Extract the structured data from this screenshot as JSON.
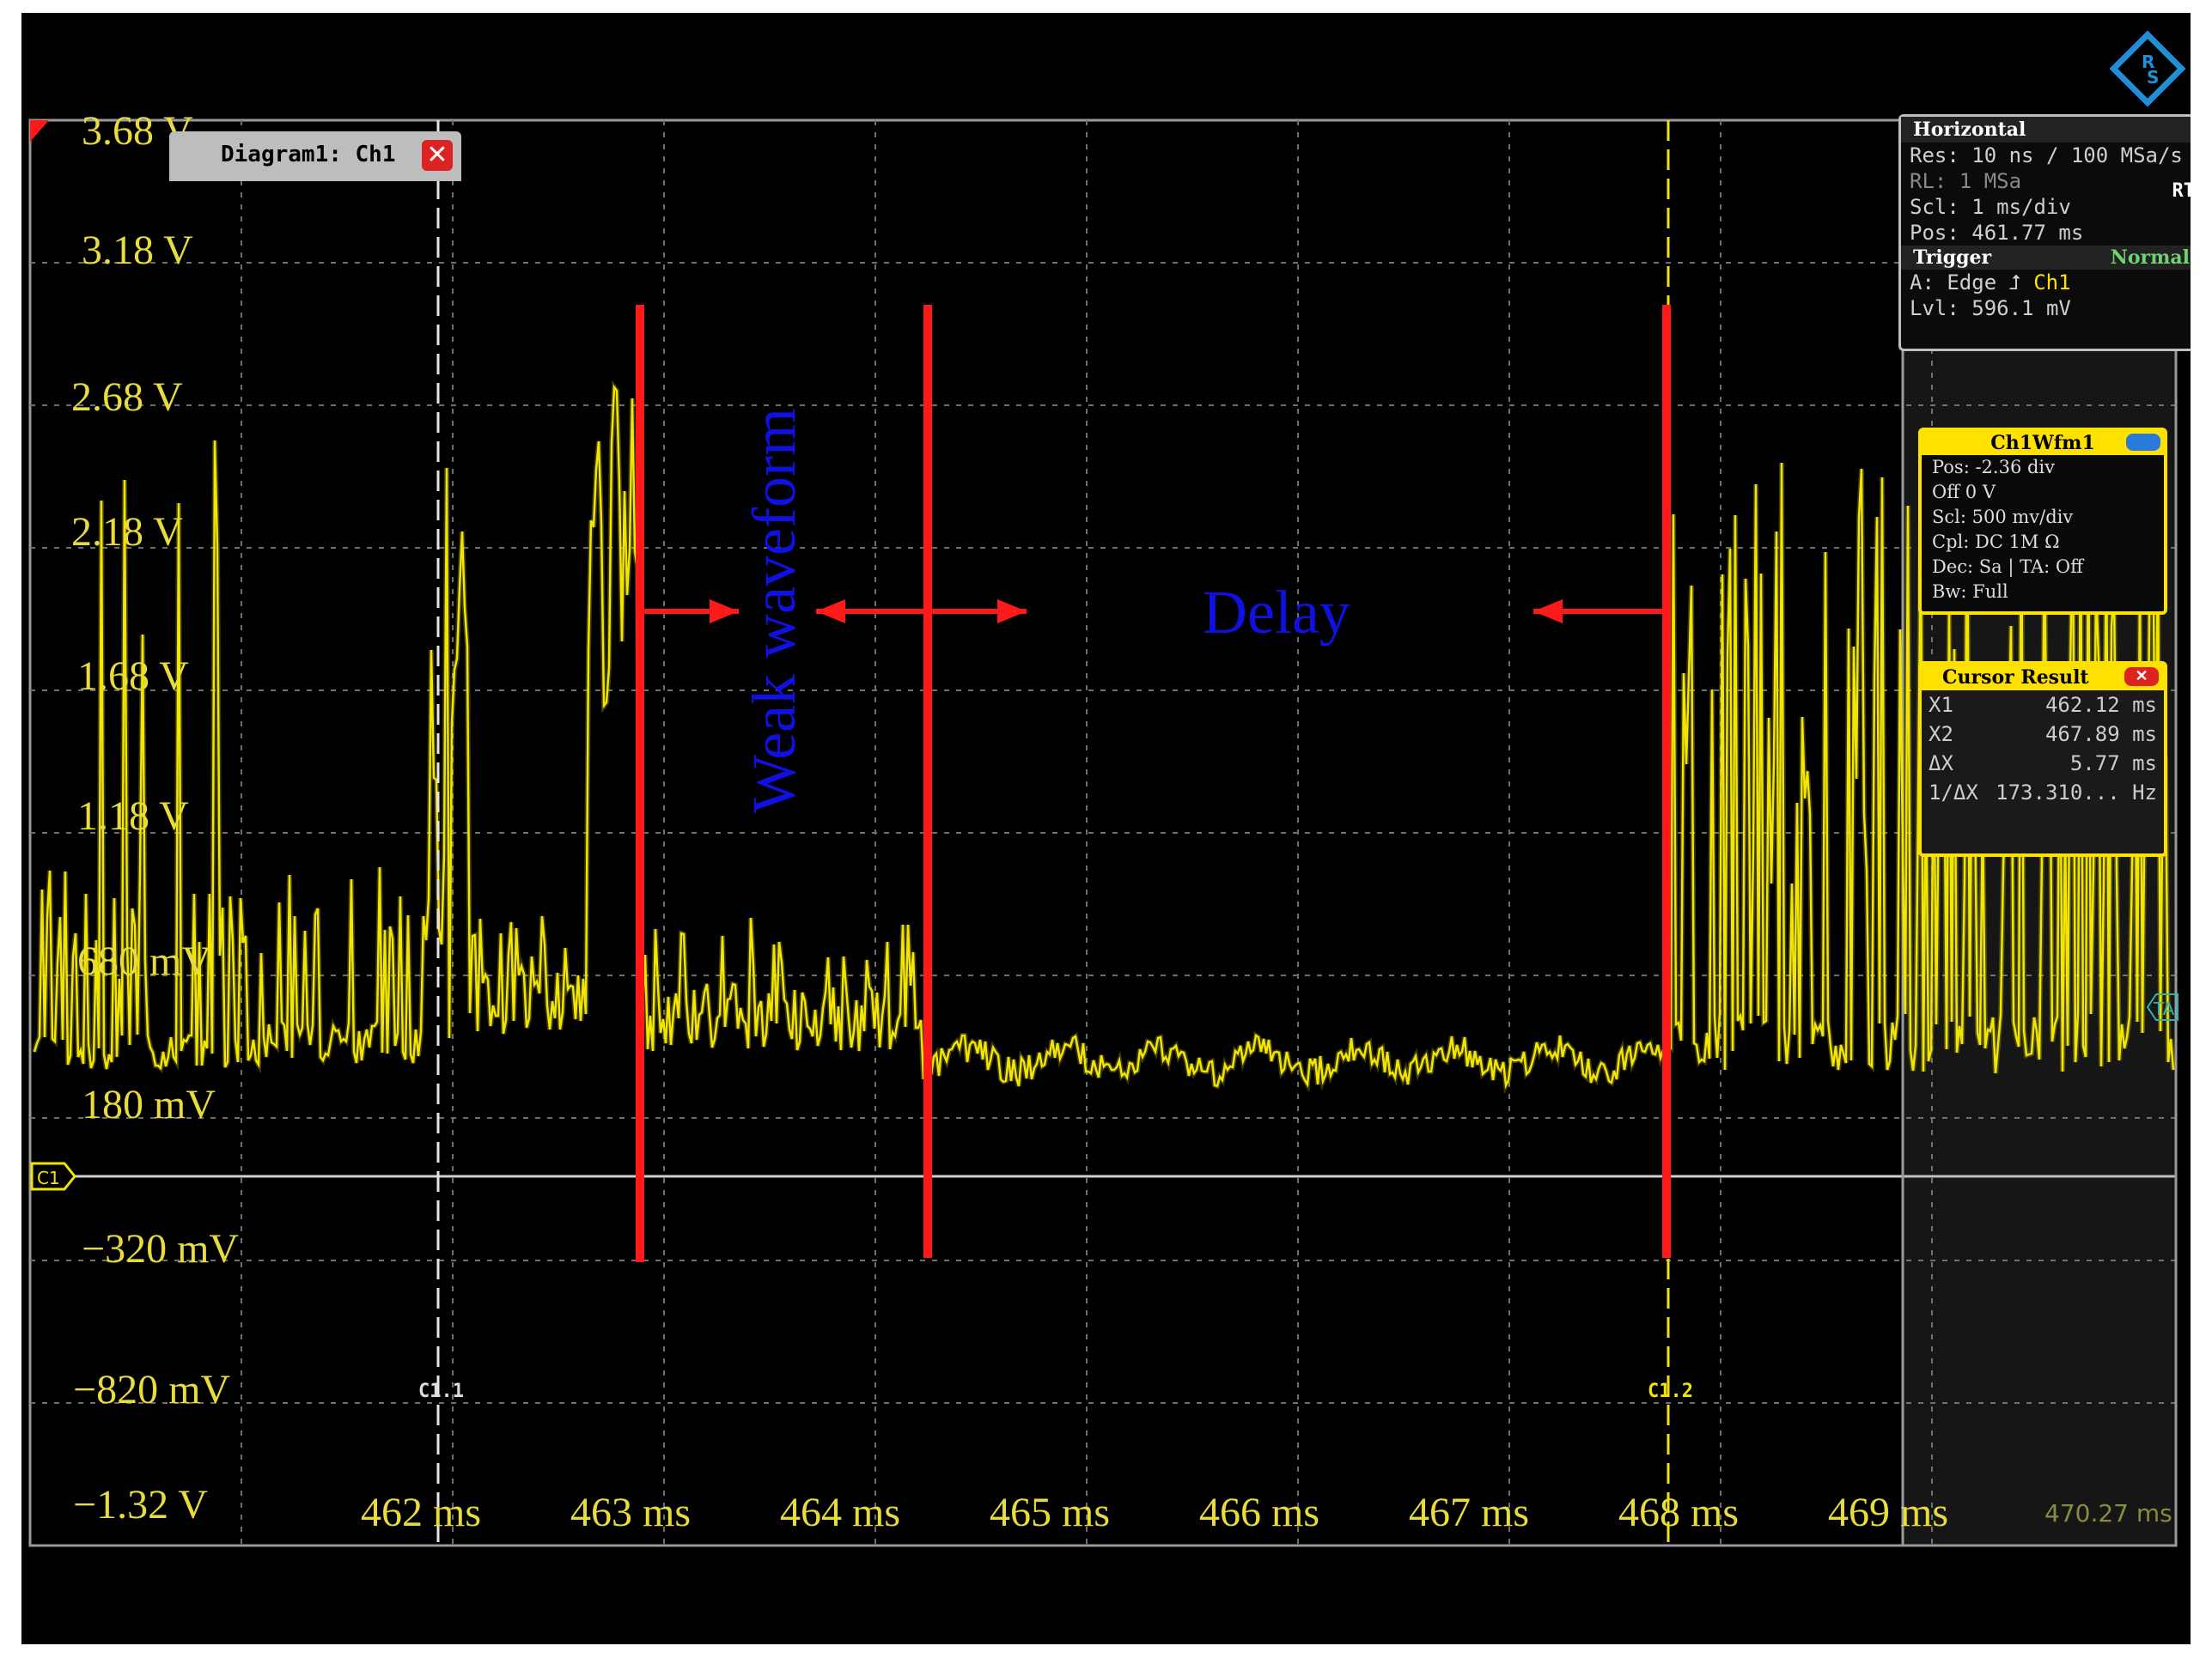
{
  "brand": {
    "logo_text": "R S",
    "color": "#1e8fd8"
  },
  "diagram_tab": {
    "label": "Diagram1: Ch1",
    "close": "✕"
  },
  "y_axis_labels": [
    "3.68 V",
    "3.18 V",
    "2.68 V",
    "2.18 V",
    "1.68 V",
    "1.18 V",
    "680 mV",
    "180 mV",
    "−320 mV",
    "−820 mV",
    "−1.32 V"
  ],
  "x_axis_labels": [
    "462 ms",
    "463 ms",
    "464 ms",
    "465 ms",
    "466 ms",
    "467 ms",
    "468 ms",
    "469 ms"
  ],
  "x_end_label": "470.27 ms",
  "markers": {
    "cursor1": "C1.1",
    "cursor2": "C1.2",
    "channel": "C1",
    "trigger": "TA"
  },
  "annotations": {
    "weak": "Weak waveform",
    "delay": "Delay"
  },
  "horizontal": {
    "title": "Horizontal",
    "res": "Res: 10 ns / 100 MSa/s",
    "rl": "RL:  1 MSa",
    "rt": "RT",
    "scl": "Scl:  1 ms/div",
    "pos": "Pos: 461.77 ms",
    "trigger_title": "Trigger",
    "trigger_mode": "Normal",
    "trigger_a": "A:   Edge ⮥",
    "trigger_ch": "Ch1",
    "trigger_lvl": "Lvl:  596.1 mV"
  },
  "ch_panel": {
    "title": "Ch1Wfm1",
    "rows": [
      "Pos:  -2.36 div",
      "Off   0 V",
      "Scl:  500 mv/div",
      "Cpl:  DC 1M Ω",
      "Dec: Sa  |  TA: Off",
      "Bw:  Full"
    ]
  },
  "cursor_panel": {
    "title": "Cursor  Result",
    "close": "✕",
    "rows": [
      {
        "k": "X1",
        "v": "462.12 ms"
      },
      {
        "k": "X2",
        "v": "467.89 ms"
      },
      {
        "k": "ΔX",
        "v": "5.77 ms"
      },
      {
        "k": "1/ΔX",
        "v": "173.310... Hz"
      }
    ]
  },
  "colors": {
    "trace": "#f2e600",
    "annotation_line": "#ff1a1a",
    "annotation_text": "#1010e0",
    "grid": "#6f6f6f",
    "label": "#e8dc3c"
  }
}
